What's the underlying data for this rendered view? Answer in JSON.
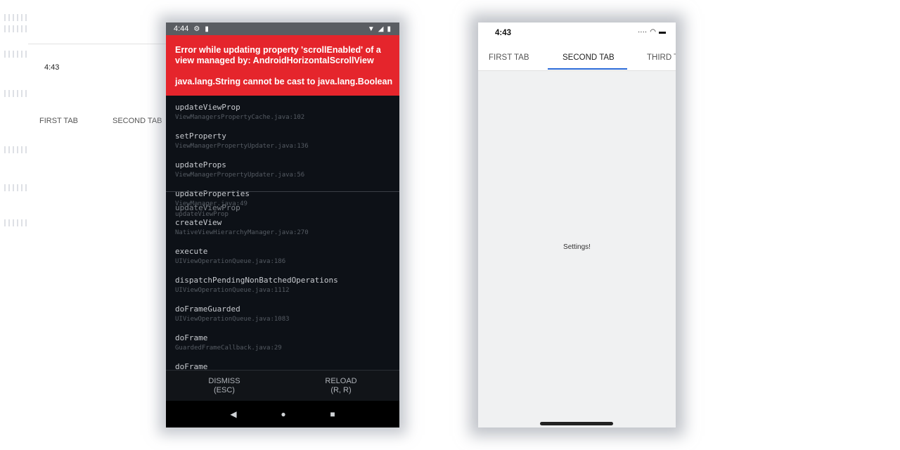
{
  "ghost": {
    "time": "4:43",
    "tabs": [
      "FIRST TAB",
      "SECOND TAB"
    ]
  },
  "android": {
    "status_time": "4:44",
    "status_icons": [
      "gear-icon",
      "sim-card-icon",
      "wifi-icon",
      "signal-icon",
      "battery-icon"
    ],
    "error": {
      "message": "Error while updating property 'scrollEnabled' of a view managed by: AndroidHorizontalScrollView",
      "exception": "java.lang.String cannot be cast to java.lang.Boolean"
    },
    "stack": [
      {
        "fn": "updateViewProp",
        "loc": "ViewManagersPropertyCache.java:102"
      },
      {
        "fn": "setProperty",
        "loc": "ViewManagerPropertyUpdater.java:136"
      },
      {
        "fn": "updateProps",
        "loc": "ViewManagerPropertyUpdater.java:56"
      },
      {
        "fn": "updateProperties",
        "loc": "ViewManager.java:49"
      },
      {
        "fn": "createView",
        "loc": "NativeViewHierarchyManager.java:270"
      },
      {
        "fn": "execute",
        "loc": "UIViewOperationQueue.java:186"
      },
      {
        "fn": "dispatchPendingNonBatchedOperations",
        "loc": "UIViewOperationQueue.java:1112"
      },
      {
        "fn": "doFrameGuarded",
        "loc": "UIViewOperationQueue.java:1083"
      },
      {
        "fn": "doFrame",
        "loc": "GuardedFrameCallback.java:29"
      },
      {
        "fn": "doFrame",
        "loc": ""
      }
    ],
    "ghost_overlay": {
      "fn": "updateViewProp",
      "loc": "updateViewProp"
    },
    "actions": {
      "dismiss": "DISMISS",
      "dismiss_key": "(ESC)",
      "reload": "RELOAD",
      "reload_key": "(R, R)"
    },
    "nav": [
      "back-icon",
      "home-icon",
      "recents-icon"
    ]
  },
  "ios": {
    "status_time": "4:43",
    "tabs": [
      "FIRST TAB",
      "SECOND TAB",
      "THIRD TAB"
    ],
    "active_tab": "SECOND TAB",
    "content": "Settings!",
    "accent": "#2b6ad8"
  }
}
